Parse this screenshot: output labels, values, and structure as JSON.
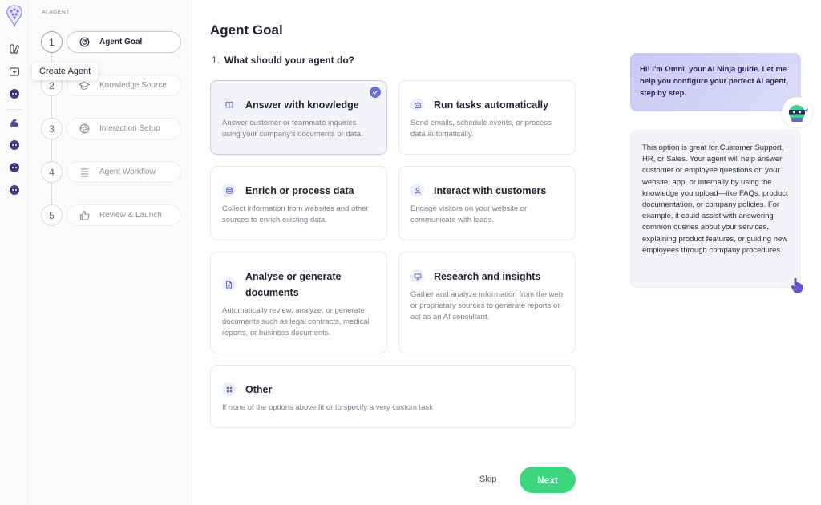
{
  "tooltip": "Create Agent",
  "sidebar_section": "AI AGENT",
  "steps": [
    {
      "num": "1",
      "label": "Agent Goal",
      "icon": "target-icon",
      "active": true
    },
    {
      "num": "2",
      "label": "Knowledge Source",
      "icon": "graduation-cap-icon",
      "active": false
    },
    {
      "num": "3",
      "label": "Interaction Setup",
      "icon": "aperture-icon",
      "active": false
    },
    {
      "num": "4",
      "label": "Agent Workflow",
      "icon": "list-lines-icon",
      "active": false
    },
    {
      "num": "5",
      "label": "Review & Launch",
      "icon": "thumbs-up-icon",
      "active": false
    }
  ],
  "main": {
    "title": "Agent Goal",
    "question_number": "1.",
    "question": "What should your agent do?"
  },
  "options": [
    {
      "title": "Answer with knowledge",
      "desc": "Answer customer or teammate inquiries using your company's documents or data.",
      "icon": "book-icon",
      "selected": true
    },
    {
      "title": "Run tasks automatically",
      "desc": "Send emails, schedule events, or process data automatically.",
      "icon": "robot-icon",
      "selected": false
    },
    {
      "title": "Enrich or process data",
      "desc": "Collect information from websites and other sources to enrich existing data.",
      "icon": "database-icon",
      "selected": false
    },
    {
      "title": "Interact with customers",
      "desc": "Engage visitors on your website or communicate with leads.",
      "icon": "user-icon",
      "selected": false
    },
    {
      "title": "Analyse or generate documents",
      "desc": "Automatically review, analyze, or generate documents such as legal contracts, medical reports, or business documents.",
      "icon": "document-icon",
      "selected": false
    },
    {
      "title": "Research and insights",
      "desc": "Gather and analyze information from the web or proprietary sources to generate reports or act as an AI consultant.",
      "icon": "monitor-icon",
      "selected": false
    },
    {
      "title": "Other",
      "desc": "If none of the options above fit or to specify a very custom task",
      "icon": "grid-dots-icon",
      "selected": false
    }
  ],
  "actions": {
    "skip": "Skip",
    "next": "Next"
  },
  "assistant": {
    "greeting": "Hi! I'm Ωmni, your AI Ninja guide. Let me help you configure your perfect AI agent, step by step.",
    "info": "This option is great for Customer Support, HR, or Sales. Your agent will help answer customer or employee questions on your website, app, or internally by using the knowledge you upload—like FAQs, product documentation, or company policies. For example, it could assist with answering common queries about your services, explaining product features, or guiding new employees through company procedures."
  },
  "colors": {
    "accent": "#6c6fd8",
    "next_button": "#3bd67d",
    "greeting_bg": "#c8c8f6"
  }
}
